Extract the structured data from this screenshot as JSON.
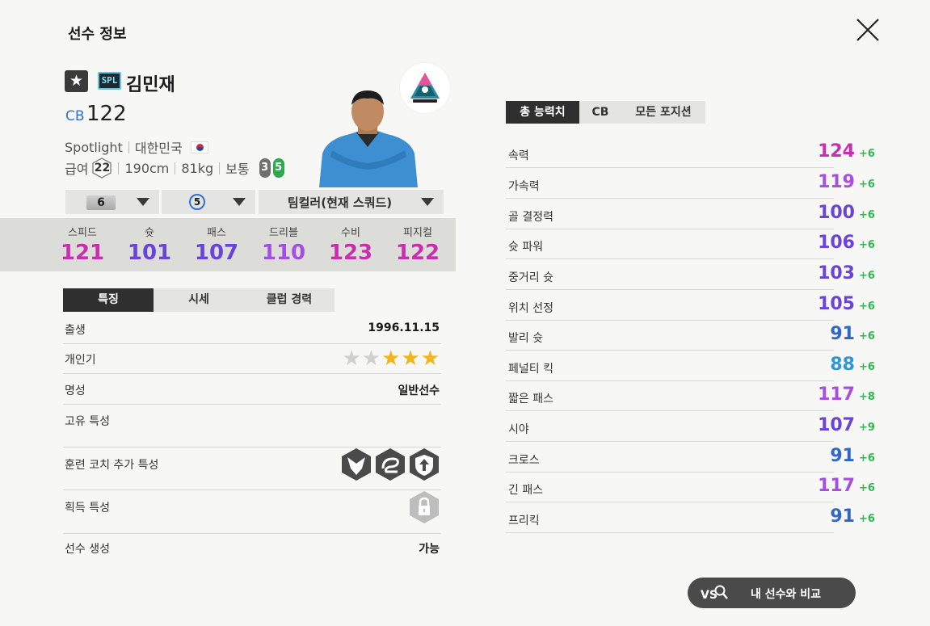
{
  "header": {
    "title": "선수 정보"
  },
  "player": {
    "season_badge": "SPL",
    "name": "김민재",
    "position": "CB",
    "overall": "122",
    "season": "Spotlight",
    "nation": "대한민국",
    "pay_label": "급여",
    "pay": "22",
    "height": "190cm",
    "weight": "81kg",
    "body_type": "보통",
    "weak_foot": "3",
    "strong_foot": "5"
  },
  "dropdowns": {
    "upgrade_level": "6",
    "team_color_level": "5",
    "team_color": "팀컬러(현재 스쿼드)"
  },
  "summary_stats": [
    {
      "label": "스피드",
      "value": "121",
      "color": "#c82fb0"
    },
    {
      "label": "슛",
      "value": "101",
      "color": "#6a43d8"
    },
    {
      "label": "패스",
      "value": "107",
      "color": "#6a43d8"
    },
    {
      "label": "드리블",
      "value": "110",
      "color": "#a64ee0"
    },
    {
      "label": "수비",
      "value": "123",
      "color": "#c82fb0"
    },
    {
      "label": "피지컬",
      "value": "122",
      "color": "#c82fb0"
    }
  ],
  "info_tabs": [
    "특징",
    "시세",
    "클럽 경력"
  ],
  "info": {
    "birth_label": "출생",
    "birth": "1996.11.15",
    "reputation_label": "개인기",
    "skill_stars": 5,
    "skill_stars_filled": 3,
    "fame_label": "명성",
    "fame": "일반선수",
    "unique_label": "고유 특성",
    "coach_label": "훈련 코치 추가 특성",
    "acquired_label": "획득 특성",
    "create_label": "선수 생성",
    "create": "가능"
  },
  "ability_tabs": [
    "총 능력치",
    "CB",
    "모든 포지션"
  ],
  "abilities": [
    {
      "label": "속력",
      "value": "124",
      "bonus": "+6",
      "color": "#c82fb0"
    },
    {
      "label": "가속력",
      "value": "119",
      "bonus": "+6",
      "color": "#a64ee0"
    },
    {
      "label": "골 결정력",
      "value": "100",
      "bonus": "+6",
      "color": "#6a43d8"
    },
    {
      "label": "슛 파워",
      "value": "106",
      "bonus": "+6",
      "color": "#6a43d8"
    },
    {
      "label": "중거리 슛",
      "value": "103",
      "bonus": "+6",
      "color": "#6a43d8"
    },
    {
      "label": "위치 선정",
      "value": "105",
      "bonus": "+6",
      "color": "#6a43d8"
    },
    {
      "label": "발리 슛",
      "value": "91",
      "bonus": "+6",
      "color": "#2e67c9"
    },
    {
      "label": "페널티 킥",
      "value": "88",
      "bonus": "+6",
      "color": "#2d96d6"
    },
    {
      "label": "짧은 패스",
      "value": "117",
      "bonus": "+8",
      "color": "#a64ee0"
    },
    {
      "label": "시야",
      "value": "107",
      "bonus": "+9",
      "color": "#6a43d8"
    },
    {
      "label": "크로스",
      "value": "91",
      "bonus": "+6",
      "color": "#2e67c9"
    },
    {
      "label": "긴 패스",
      "value": "117",
      "bonus": "+6",
      "color": "#a64ee0"
    },
    {
      "label": "프리킥",
      "value": "91",
      "bonus": "+6",
      "color": "#2e67c9"
    }
  ],
  "compare_button": {
    "badge": "VS",
    "label": "내 선수와 비교"
  }
}
